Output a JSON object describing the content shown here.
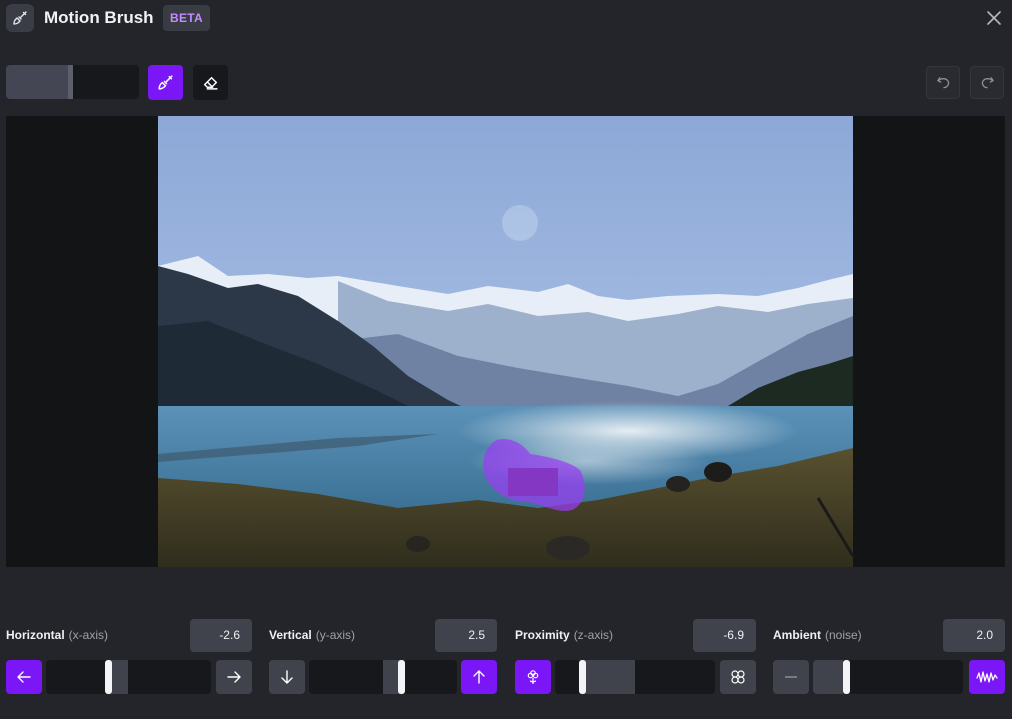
{
  "header": {
    "title": "Motion Brush",
    "badge": "BETA",
    "icon": "paintbrush-icon",
    "close_icon": "close-icon"
  },
  "toolbar": {
    "brush_size_fraction": 0.5,
    "brush_icon": "paintbrush-icon",
    "eraser_icon": "eraser-icon",
    "undo_icon": "undo-icon",
    "redo_icon": "redo-icon",
    "active_tool": "brush"
  },
  "canvas": {
    "image": "mountain-lake-photo",
    "mask_color": "#9a3df2"
  },
  "controls": {
    "horizontal": {
      "label": "Horizontal",
      "axis": "(x-axis)",
      "value": "-2.6",
      "dec_icon": "arrow-left-icon",
      "inc_icon": "arrow-right-icon"
    },
    "vertical": {
      "label": "Vertical",
      "axis": "(y-axis)",
      "value": "2.5",
      "dec_icon": "arrow-down-icon",
      "inc_icon": "arrow-up-icon"
    },
    "proximity": {
      "label": "Proximity",
      "axis": "(z-axis)",
      "value": "-6.9",
      "dec_icon": "flower-small-icon",
      "inc_icon": "flower-large-icon"
    },
    "ambient": {
      "label": "Ambient",
      "axis": "(noise)",
      "value": "2.0",
      "dec_icon": "calm-icon",
      "inc_icon": "noise-wave-icon"
    }
  },
  "colors": {
    "accent": "#7b16f6",
    "background": "#23252a",
    "field": "#40434c",
    "beta": "#c38bff"
  }
}
